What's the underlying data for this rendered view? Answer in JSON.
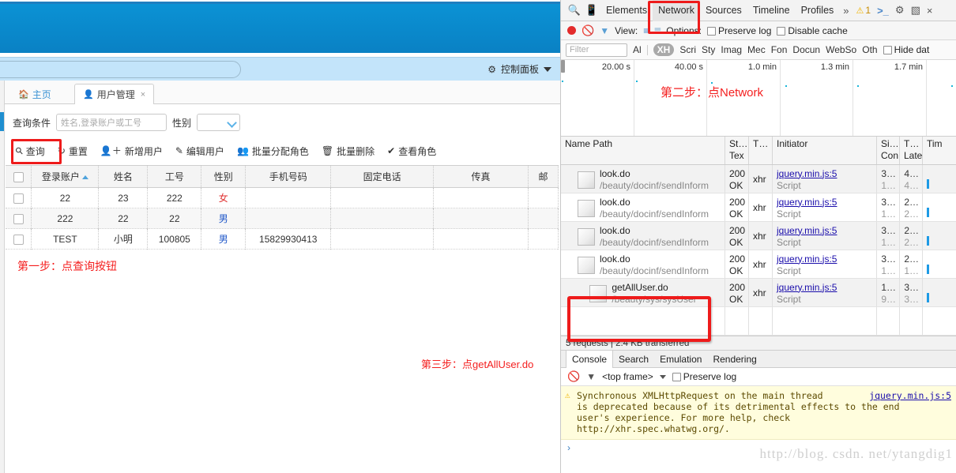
{
  "app": {
    "control_panel_label": "控制面板",
    "tabs": [
      {
        "label": "主页",
        "icon": "home-icon",
        "closable": false
      },
      {
        "label": "用户管理",
        "icon": "user-icon",
        "closable": true,
        "close_label": "×"
      }
    ],
    "query": {
      "condition_label": "查询条件",
      "keyword_placeholder": "姓名,登录账户或工号",
      "keyword_value": "",
      "sex_label": "性别",
      "sex_value": ""
    },
    "toolbar": [
      {
        "label": "查询",
        "icon": "search-icon"
      },
      {
        "label": "重置",
        "icon": "refresh-icon"
      },
      {
        "label": "新增用户",
        "icon": "user-add-icon"
      },
      {
        "label": "编辑用户",
        "icon": "pencil-icon"
      },
      {
        "label": "批量分配角色",
        "icon": "users-icon"
      },
      {
        "label": "批量删除",
        "icon": "trash-icon"
      },
      {
        "label": "查看角色",
        "icon": "info-icon"
      }
    ],
    "table": {
      "columns": [
        "",
        "登录账户",
        "姓名",
        "工号",
        "性别",
        "手机号码",
        "固定电话",
        "传真",
        "邮"
      ],
      "sorted_column": "登录账户",
      "sort_direction": "asc",
      "rows": [
        {
          "account": "22",
          "name": "23",
          "jobno": "222",
          "sex": "女",
          "mobile": "",
          "tel": "",
          "fax": "",
          "mail": ""
        },
        {
          "account": "222",
          "name": "22",
          "jobno": "22",
          "sex": "男",
          "mobile": "",
          "tel": "",
          "fax": "",
          "mail": ""
        },
        {
          "account": "TEST",
          "name": "小明",
          "jobno": "100805",
          "sex": "男",
          "mobile": "15829930413",
          "tel": "",
          "fax": "",
          "mail": ""
        }
      ]
    }
  },
  "annotations": {
    "step1": "第一步：点查询按钮",
    "step2": "第二步：点Network",
    "step3": "第三步：点getAllUser.do"
  },
  "devtools": {
    "tabs": [
      "Elements",
      "Network",
      "Sources",
      "Timeline",
      "Profiles"
    ],
    "selected_tab": "Network",
    "more_glyph": "»",
    "warning_count": "1",
    "icons": {
      "search": "search-icon",
      "device": "device-icon",
      "console_toggle": "console-prompt-icon",
      "settings": "gear-icon",
      "dock": "dock-icon",
      "close": "close-icon"
    },
    "controls": {
      "record_label": "record-button",
      "clear_label": "clear-button",
      "filter_label": "filter-button",
      "view_label": "View:",
      "options_label": "Options:",
      "preserve_log": "Preserve log",
      "preserve_log_checked": false,
      "disable_cache": "Disable cache",
      "disable_cache_checked": false
    },
    "filterbar": {
      "placeholder": "Filter",
      "value": "",
      "types": [
        "Al",
        "XH",
        "Scri",
        "Sty",
        "Imag",
        "Mec",
        "Fon",
        "Docun",
        "WebSo",
        "Oth"
      ],
      "active_type": "XH",
      "hide_data_urls": "Hide dat",
      "hide_data_urls_checked": false
    },
    "overview": {
      "ticks": [
        "20.00 s",
        "40.00 s",
        "1.0 min",
        "1.3 min",
        "1.7 min"
      ]
    },
    "network": {
      "columns": [
        {
          "l1": "Name",
          "l2": "Path"
        },
        {
          "l1": "St…",
          "l2": "Tex"
        },
        {
          "l1": "T…",
          "l2": ""
        },
        {
          "l1": "Initiator",
          "l2": ""
        },
        {
          "l1": "Si…",
          "l2": "Con"
        },
        {
          "l1": "T…",
          "l2": "Late"
        },
        {
          "l1": "Tim",
          "l2": ""
        }
      ],
      "rows": [
        {
          "name": "look.do",
          "path": "/beauty/docinf/sendInform",
          "status": "200",
          "status_text": "OK",
          "type": "xhr",
          "initiator": "jquery.min.js:5",
          "initiator_sub": "Script",
          "size": "3…",
          "size_sub": "1…",
          "time": "4…",
          "time_sub": "4…"
        },
        {
          "name": "look.do",
          "path": "/beauty/docinf/sendInform",
          "status": "200",
          "status_text": "OK",
          "type": "xhr",
          "initiator": "jquery.min.js:5",
          "initiator_sub": "Script",
          "size": "3…",
          "size_sub": "1…",
          "time": "2…",
          "time_sub": "2…"
        },
        {
          "name": "look.do",
          "path": "/beauty/docinf/sendInform",
          "status": "200",
          "status_text": "OK",
          "type": "xhr",
          "initiator": "jquery.min.js:5",
          "initiator_sub": "Script",
          "size": "3…",
          "size_sub": "1…",
          "time": "2…",
          "time_sub": "2…"
        },
        {
          "name": "look.do",
          "path": "/beauty/docinf/sendInform",
          "status": "200",
          "status_text": "OK",
          "type": "xhr",
          "initiator": "jquery.min.js:5",
          "initiator_sub": "Script",
          "size": "3…",
          "size_sub": "1…",
          "time": "2…",
          "time_sub": "1…"
        },
        {
          "name": "getAllUser.do",
          "path": "/beauty/sys/sysUser",
          "status": "200",
          "status_text": "OK",
          "type": "xhr",
          "initiator": "jquery.min.js:5",
          "initiator_sub": "Script",
          "size": "1…",
          "size_sub": "9…",
          "time": "3…",
          "time_sub": "3…"
        }
      ],
      "summary": "5 requests  |  2.4 KB transferred"
    },
    "drawer": {
      "tabs": [
        "Console",
        "Search",
        "Emulation",
        "Rendering"
      ],
      "selected_tab": "Console",
      "frame_selector": "<top frame>",
      "preserve_log": "Preserve log",
      "preserve_log_checked": false,
      "message": "Synchronous XMLHttpRequest on the main thread\nis deprecated because of its detrimental effects to the end\nuser's experience. For more help, check\nhttp://xhr.spec.whatwg.org/.",
      "message_source": "jquery.min.js:5",
      "prompt_glyph": "›"
    }
  },
  "watermark": "http://blog. csdn. net/ytangdig1",
  "colors": {
    "app_header_blue": "#0a86c8",
    "app_subbar_blue": "#c3e4fa",
    "annotation_red": "#f41f1f",
    "highlight_red": "#ee1b1b",
    "link_blue": "#1a0dab",
    "female_red": "#e03131",
    "male_blue": "#2158c9"
  }
}
